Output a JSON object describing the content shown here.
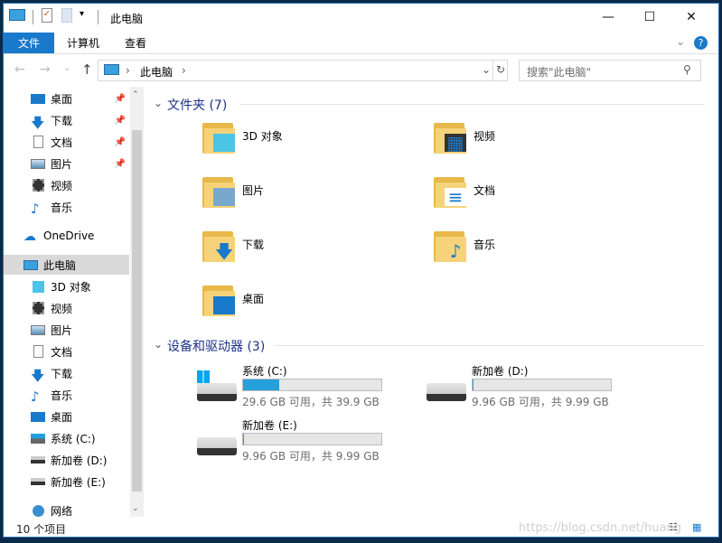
{
  "window": {
    "title": "此电脑",
    "minimize": "—",
    "maximize": "☐",
    "close": "✕"
  },
  "ribbon": {
    "tabs": [
      {
        "label": "文件"
      },
      {
        "label": "计算机"
      },
      {
        "label": "查看"
      }
    ]
  },
  "address": {
    "path": "此电脑",
    "refresh": "↻",
    "dropdown": "⌄"
  },
  "search": {
    "placeholder": "搜索\"此电脑\""
  },
  "nav": {
    "items": [
      {
        "label": "桌面",
        "icon": "desktop-icon",
        "pinned": true
      },
      {
        "label": "下载",
        "icon": "download-icon",
        "pinned": true
      },
      {
        "label": "文档",
        "icon": "document-icon",
        "pinned": true
      },
      {
        "label": "图片",
        "icon": "picture-icon",
        "pinned": true
      },
      {
        "label": "视频",
        "icon": "video-icon"
      },
      {
        "label": "音乐",
        "icon": "music-icon"
      },
      {
        "label": "OneDrive",
        "icon": "cloud-icon"
      },
      {
        "label": "此电脑",
        "icon": "computer-icon",
        "selected": true
      },
      {
        "label": "3D 对象",
        "icon": "cube-icon"
      },
      {
        "label": "视频",
        "icon": "video-icon"
      },
      {
        "label": "图片",
        "icon": "picture-icon"
      },
      {
        "label": "文档",
        "icon": "document-icon"
      },
      {
        "label": "下载",
        "icon": "download-icon"
      },
      {
        "label": "音乐",
        "icon": "music-icon"
      },
      {
        "label": "桌面",
        "icon": "desktop-icon"
      },
      {
        "label": "系统 (C:)",
        "icon": "windows-drive-icon"
      },
      {
        "label": "新加卷 (D:)",
        "icon": "drive-icon"
      },
      {
        "label": "新加卷 (E:)",
        "icon": "drive-icon"
      },
      {
        "label": "网络",
        "icon": "network-icon"
      }
    ]
  },
  "folders": {
    "header": "文件夹 (7)",
    "items": [
      {
        "label": "3D 对象",
        "overlay": "cube"
      },
      {
        "label": "视频",
        "overlay": "film"
      },
      {
        "label": "图片",
        "overlay": "picture"
      },
      {
        "label": "文档",
        "overlay": "document"
      },
      {
        "label": "下载",
        "overlay": "arrow"
      },
      {
        "label": "音乐",
        "overlay": "note"
      },
      {
        "label": "桌面",
        "overlay": "screen"
      }
    ]
  },
  "drives": {
    "header": "设备和驱动器 (3)",
    "items": [
      {
        "label": "系统 (C:)",
        "detail": "29.6 GB 可用，共 39.9 GB",
        "used_fraction": 0.26,
        "windows": true
      },
      {
        "label": "新加卷 (D:)",
        "detail": "9.96 GB 可用，共 9.99 GB",
        "used_fraction": 0.003
      },
      {
        "label": "新加卷 (E:)",
        "detail": "9.96 GB 可用，共 9.99 GB",
        "used_fraction": 0.003
      }
    ]
  },
  "status": {
    "count": "10 个项目"
  },
  "watermark": "https://blog.csdn.net/huang",
  "colors": {
    "accent": "#1979ca",
    "bar": "#26a0da",
    "group_header": "#1e3287"
  }
}
